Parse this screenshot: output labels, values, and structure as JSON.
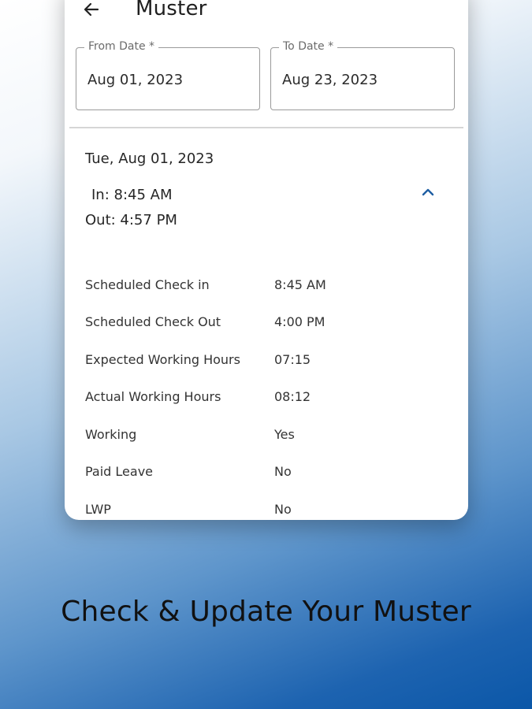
{
  "header": {
    "title": "Muster",
    "back_icon": "arrow-left-icon"
  },
  "filters": {
    "from_date": {
      "label": "From Date *",
      "value": "Aug 01, 2023"
    },
    "to_date": {
      "label": "To Date *",
      "value": "Aug 23, 2023"
    }
  },
  "entry": {
    "date": "Tue, Aug 01, 2023",
    "in": "In: 8:45 AM",
    "out": "Out: 4:57 PM",
    "expand_icon": "chevron-up-icon",
    "accent_color": "#1f5fa3",
    "details": [
      {
        "label": "Scheduled Check in",
        "value": "8:45 AM"
      },
      {
        "label": "Scheduled Check Out",
        "value": "4:00 PM"
      },
      {
        "label": "Expected Working Hours",
        "value": "07:15"
      },
      {
        "label": "Actual Working Hours",
        "value": "08:12"
      },
      {
        "label": "Working",
        "value": "Yes"
      },
      {
        "label": "Paid Leave",
        "value": "No"
      },
      {
        "label": "LWP",
        "value": "No"
      }
    ]
  },
  "promo": {
    "caption": "Check & Update Your Muster"
  }
}
